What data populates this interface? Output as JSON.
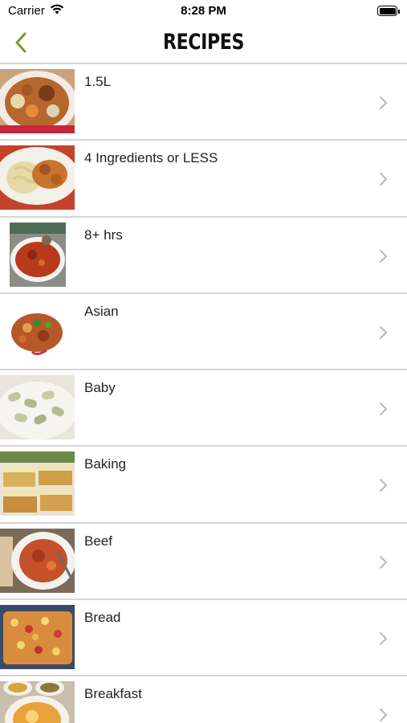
{
  "status_bar": {
    "carrier": "Carrier",
    "time": "8:28 PM"
  },
  "nav": {
    "title": "RECIPES",
    "back_icon": "chevron-left-icon"
  },
  "colors": {
    "accent": "#7a9a2e",
    "divider": "#d6d6d6",
    "chevron": "#b8b8b8"
  },
  "categories": [
    {
      "label": "1.5L"
    },
    {
      "label": "4 Ingredients or LESS"
    },
    {
      "label": "8+ hrs"
    },
    {
      "label": "Asian"
    },
    {
      "label": "Baby"
    },
    {
      "label": "Baking"
    },
    {
      "label": "Beef"
    },
    {
      "label": "Bread"
    },
    {
      "label": "Breakfast"
    }
  ]
}
